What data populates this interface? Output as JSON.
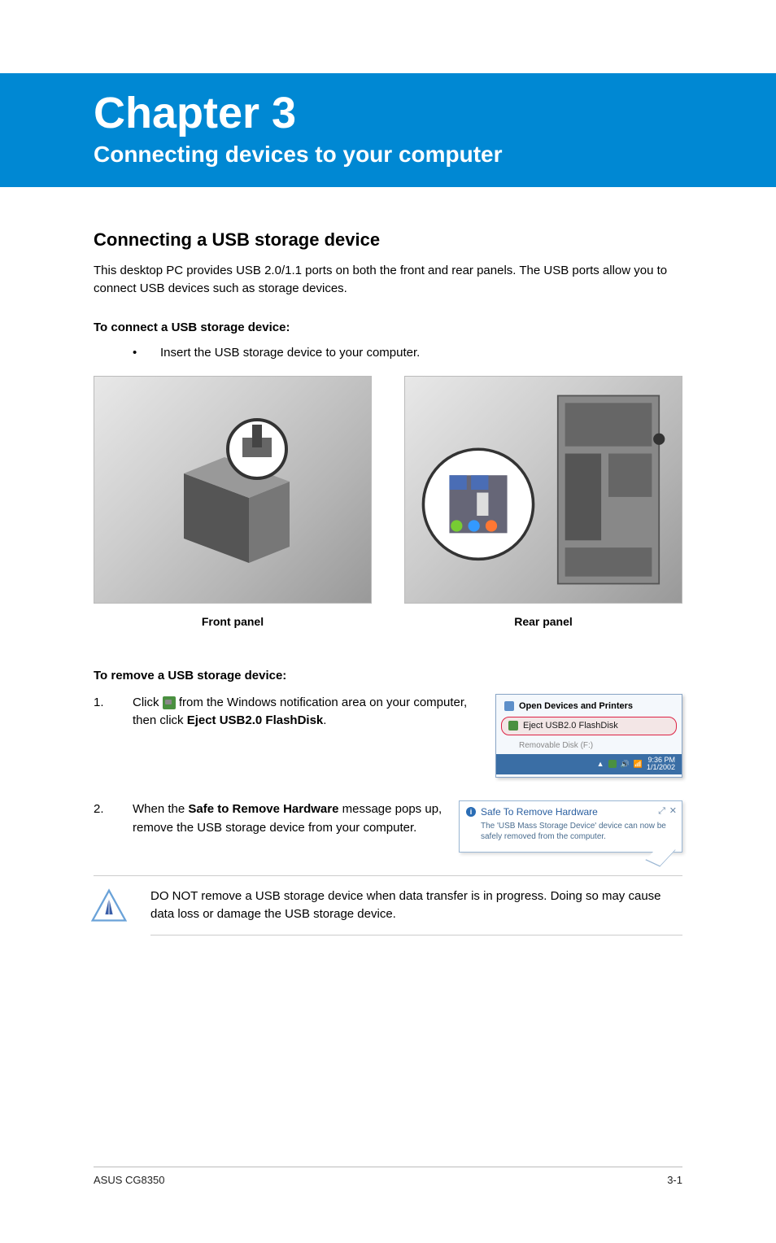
{
  "banner": {
    "title": "Chapter 3",
    "subtitle": "Connecting devices to your computer"
  },
  "section_heading": "Connecting a USB storage device",
  "intro_paragraph": "This desktop PC provides USB 2.0/1.1 ports on both the front and rear panels. The USB ports allow you to connect USB devices such as storage devices.",
  "connect_heading": "To connect a USB storage device:",
  "connect_step_marker": "•",
  "connect_step_text": "Insert the USB storage device to your computer.",
  "figures": {
    "front_caption": "Front panel",
    "rear_caption": "Rear panel"
  },
  "remove_heading": "To remove a USB storage device:",
  "step1": {
    "num": "1.",
    "text_a": "Click ",
    "text_b": " from the Windows notification area on your computer, then click ",
    "bold": "Eject USB2.0 FlashDisk",
    "text_c": "."
  },
  "step2": {
    "num": "2.",
    "text_a": "When the ",
    "bold": "Safe to Remove Hardware",
    "text_b": " message pops up, remove the USB storage device from your computer."
  },
  "eject_menu": {
    "item1": "Open Devices and Printers",
    "item2": "Eject USB2.0 FlashDisk",
    "item3": "Removable Disk (F:)",
    "time": "9:36 PM",
    "date": "1/1/2002"
  },
  "safe_balloon": {
    "title": "Safe To Remove Hardware",
    "msg": "The 'USB Mass Storage Device' device can now be safely removed from the computer."
  },
  "warning_text": "DO NOT remove a USB storage device when data transfer is in progress. Doing so may cause data loss or damage the USB storage device.",
  "footer": {
    "left": "ASUS CG8350",
    "right": "3-1"
  }
}
